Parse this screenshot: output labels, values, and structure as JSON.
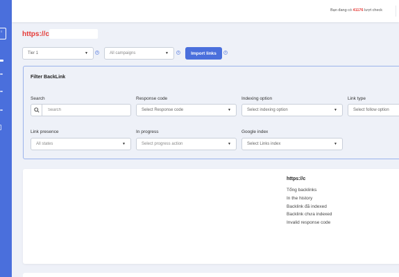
{
  "sidebar": {
    "toggle_label": "≡"
  },
  "topbar": {
    "prefix": "Bạn đang có",
    "count": "41176",
    "suffix": "lượt check"
  },
  "domain": {
    "text": "https://c"
  },
  "controls": {
    "tier": "Tier 1",
    "campaigns": "All campaigns",
    "import_label": "Import links",
    "help": "?"
  },
  "filter": {
    "title": "Filter BackLink",
    "search": {
      "label": "Search",
      "placeholder": "Search"
    },
    "response_code": {
      "label": "Response code",
      "value": "Select Response code"
    },
    "indexing_option": {
      "label": "Indexing option",
      "value": "Select indexing option"
    },
    "link_type": {
      "label": "Link type",
      "value": "Select follow option"
    },
    "link_presence": {
      "label": "Link presence",
      "value": "All states"
    },
    "in_progress": {
      "label": "In progress",
      "value": "Select progress action"
    },
    "google_index": {
      "label": "Google index",
      "value": "Select Links index"
    }
  },
  "stats": {
    "title": "https://c",
    "items": [
      "Tổng backlinks",
      "In the history",
      "Backlink đã indexed",
      "Backlink chưa indexed",
      "Invalid response code"
    ]
  },
  "colors": {
    "accent": "#4a6fdc",
    "domain": "#e53935"
  }
}
